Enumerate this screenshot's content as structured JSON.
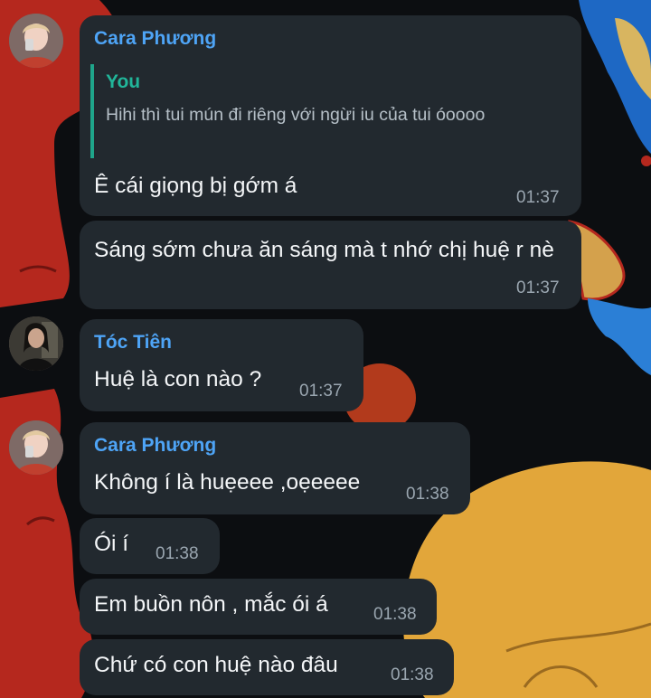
{
  "chat": {
    "messages": [
      {
        "sender": "Cara Phương",
        "reply": {
          "author": "You",
          "text": "Hihi thì tui mún đi riêng với ngừi iu của tui óoooo"
        },
        "text": "Ê cái giọng bị gớm á",
        "time": "01:37"
      },
      {
        "text": "Sáng sớm chưa ăn sáng mà t nhớ chị huệ r nè",
        "time": "01:37"
      },
      {
        "sender": "Tóc Tiên",
        "text": "Huệ là con nào ?",
        "time": "01:37"
      },
      {
        "sender": "Cara Phương",
        "text": "Không í là huẹeee ,oẹeeee",
        "time": "01:38"
      },
      {
        "text": "Ói í",
        "time": "01:38"
      },
      {
        "text": "Em buồn nôn , mắc ói á",
        "time": "01:38"
      },
      {
        "text": "Chứ có con huệ nào đâu",
        "time": "01:38"
      }
    ]
  },
  "colors": {
    "bubble": "#22292f",
    "sender_name": "#4ea4f6",
    "reply_accent": "#1fa58b",
    "timestamp": "#9aa6b0"
  }
}
